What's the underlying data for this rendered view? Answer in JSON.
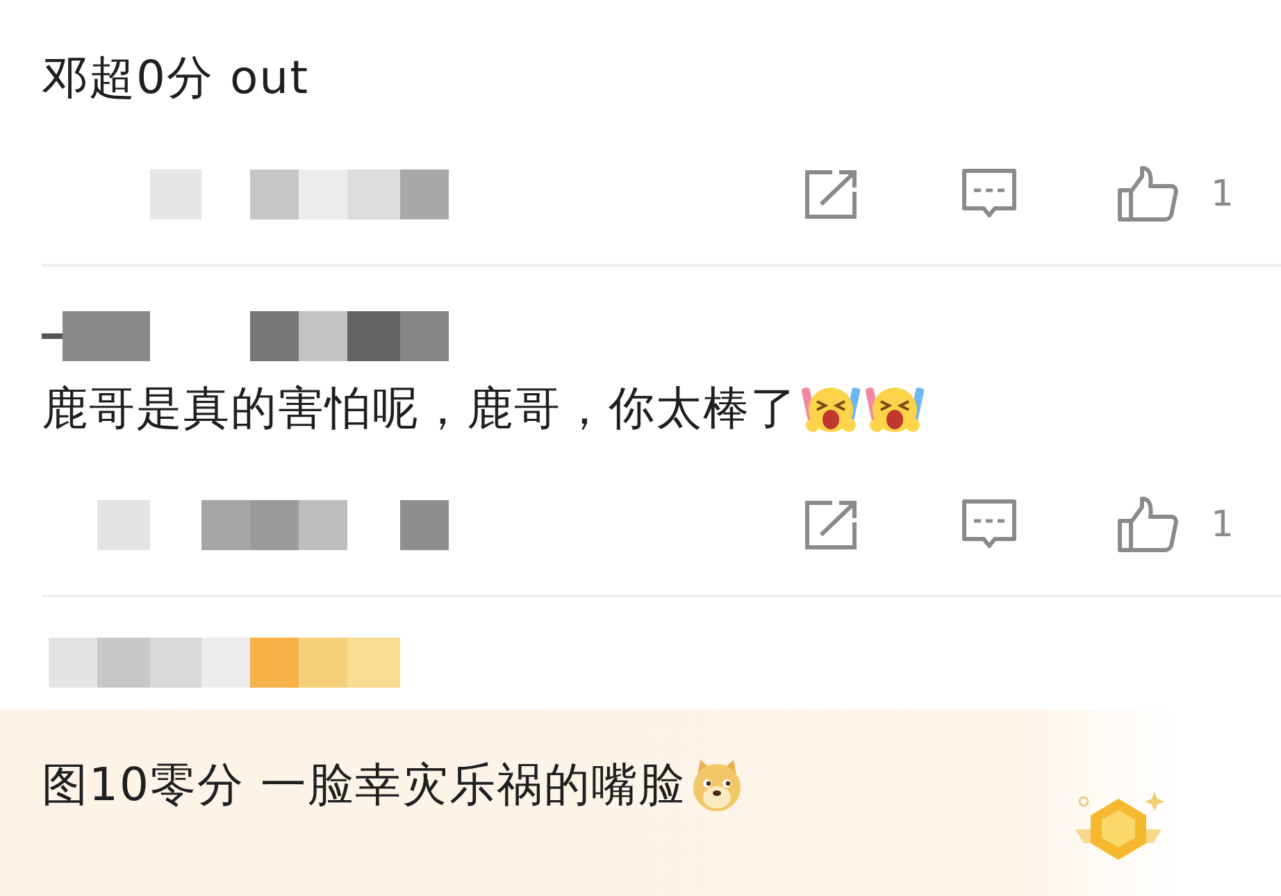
{
  "comments": [
    {
      "text": "邓超0分 out",
      "highlighted": false,
      "meta": {
        "likes": "1"
      }
    },
    {
      "author": {
        "kind": "pixelated"
      },
      "text": "鹿哥是真的害怕呢，鹿哥，你太棒了",
      "emojis": [
        {
          "kind": "cheer"
        },
        {
          "kind": "cheer"
        }
      ],
      "highlighted": false,
      "meta": {
        "likes": "1"
      }
    },
    {
      "author": {
        "kind": "pixelated"
      },
      "text": "图10零分 一脸幸灾乐祸的嘴脸",
      "emojis": [
        {
          "kind": "dog"
        }
      ],
      "highlighted": true
    }
  ]
}
